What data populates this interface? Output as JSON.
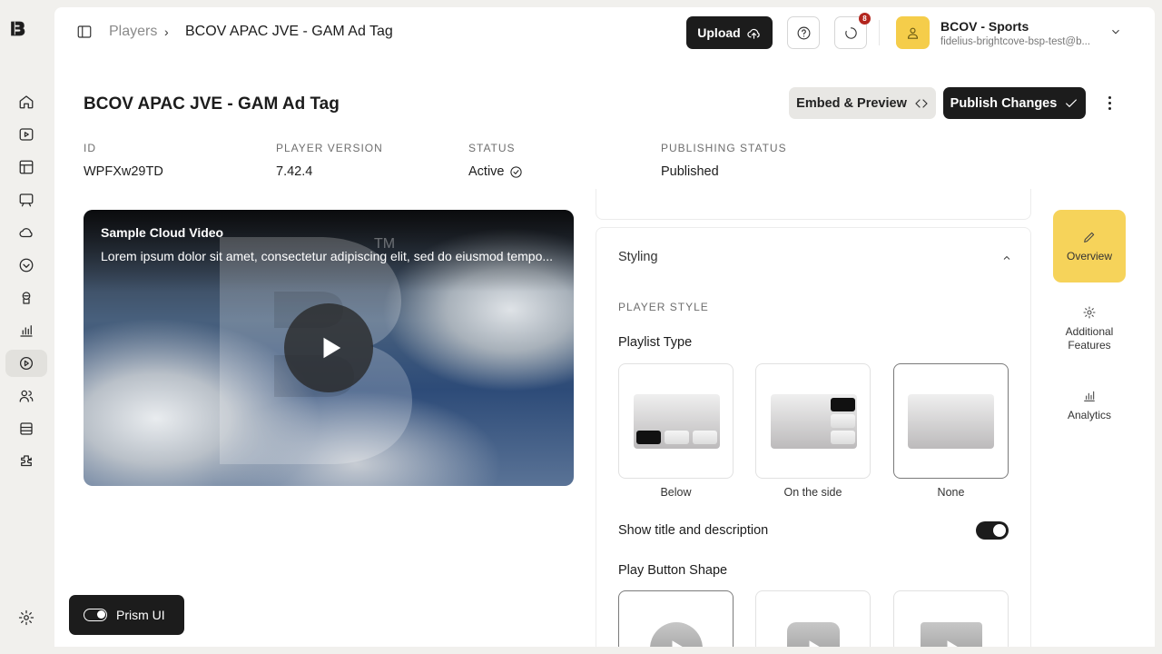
{
  "nav": {
    "items": [
      "home-icon",
      "video-icon",
      "grid-icon",
      "monitor-icon",
      "cloud-icon",
      "heart-shield-icon",
      "flask-icon",
      "analytics-icon",
      "players-icon",
      "users-icon",
      "shop-icon",
      "plugin-icon"
    ],
    "active": "players-icon"
  },
  "breadcrumb": {
    "parent": "Players",
    "current": "BCOV APAC JVE - GAM Ad Tag"
  },
  "topbar": {
    "upload_label": "Upload",
    "notification_count": "8"
  },
  "account": {
    "name": "BCOV - Sports",
    "email": "fidelius-brightcove-bsp-test@b..."
  },
  "page": {
    "title": "BCOV APAC JVE - GAM Ad Tag",
    "embed_label": "Embed & Preview",
    "publish_label": "Publish Changes"
  },
  "meta": {
    "id_label": "ID",
    "id_value": "WPFXw29TD",
    "version_label": "PLAYER VERSION",
    "version_value": "7.42.4",
    "status_label": "STATUS",
    "status_value": "Active",
    "publishing_label": "PUBLISHING STATUS",
    "publishing_value": "Published"
  },
  "video": {
    "title": "Sample Cloud Video",
    "description": "Lorem ipsum dolor sit amet, consectetur adipiscing elit, sed do eiusmod tempo...",
    "watermark": "TM"
  },
  "prism": {
    "label": "Prism UI",
    "enabled": true
  },
  "styling": {
    "header": "Styling",
    "section": "PLAYER STYLE",
    "playlist_type_label": "Playlist Type",
    "playlist_options": [
      "Below",
      "On the side",
      "None"
    ],
    "playlist_selected": "None",
    "show_title_label": "Show title and description",
    "show_title_on": true,
    "play_button_label": "Play Button Shape",
    "play_button_selected": 0
  },
  "right_tabs": {
    "overview": "Overview",
    "features_1": "Additional",
    "features_2": "Features",
    "analytics": "Analytics"
  },
  "colors": {
    "accent": "#f5cd4a",
    "primary": "#1c1c1c",
    "badge": "#b3261e"
  }
}
